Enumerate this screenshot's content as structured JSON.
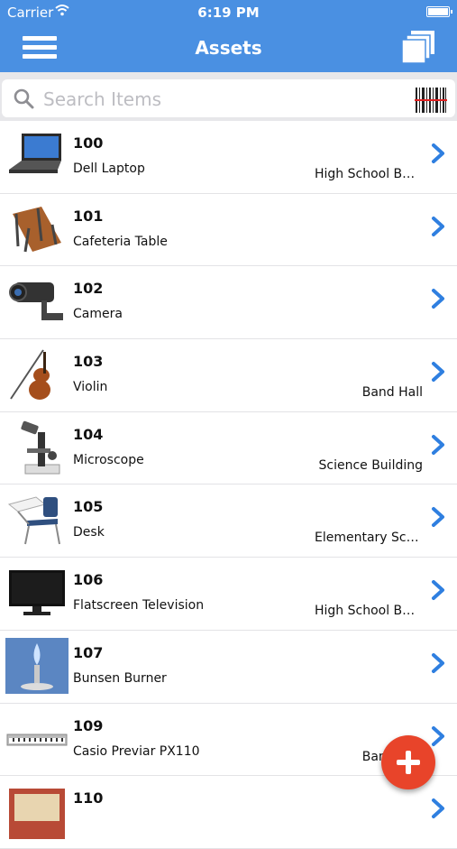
{
  "status_bar": {
    "carrier": "Carrier",
    "time": "6:19 PM"
  },
  "nav": {
    "title": "Assets"
  },
  "search": {
    "placeholder": "Search Items"
  },
  "items": [
    {
      "number": "100",
      "name": "Dell Laptop",
      "location": "High School Building",
      "icon": "laptop-icon"
    },
    {
      "number": "101",
      "name": "Cafeteria Table",
      "location": "",
      "icon": "table-icon"
    },
    {
      "number": "102",
      "name": "Camera",
      "location": "",
      "icon": "camera-icon"
    },
    {
      "number": "103",
      "name": "Violin",
      "location": "Band Hall",
      "icon": "violin-icon"
    },
    {
      "number": "104",
      "name": "Microscope",
      "location": "Science Building",
      "icon": "microscope-icon"
    },
    {
      "number": "105",
      "name": "Desk",
      "location": "Elementary School",
      "icon": "desk-icon"
    },
    {
      "number": "106",
      "name": "Flatscreen Television",
      "location": "High School Building",
      "icon": "television-icon"
    },
    {
      "number": "107",
      "name": "Bunsen Burner",
      "location": "",
      "icon": "bunsen-burner-icon"
    },
    {
      "number": "109",
      "name": "Casio Previar PX110",
      "location": "Band Hall",
      "icon": "keyboard-icon"
    },
    {
      "number": "110",
      "name": "",
      "location": "",
      "icon": "book-icon"
    }
  ],
  "colors": {
    "nav_blue": "#4a90e2",
    "chevron_blue": "#2f7fe0",
    "fab_red": "#e8442a"
  }
}
